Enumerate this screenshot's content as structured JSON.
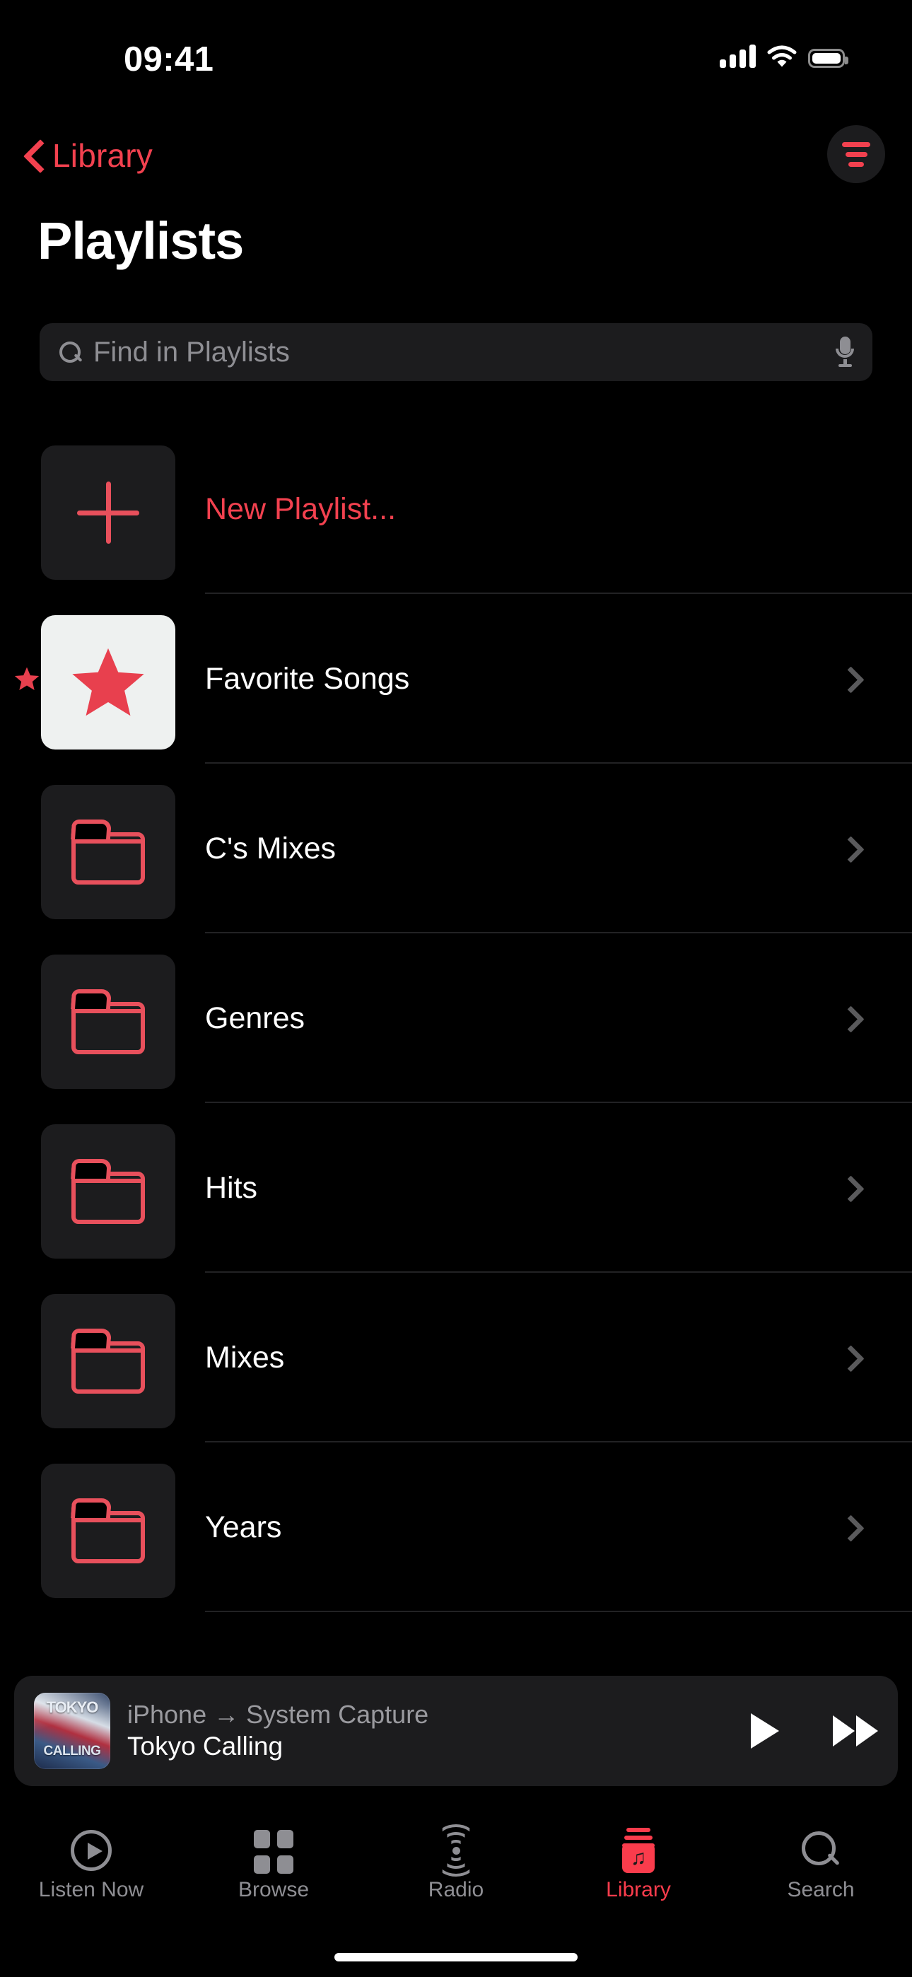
{
  "status_bar": {
    "time": "09:41",
    "cellular_icon": "cellular-bars-icon",
    "wifi_icon": "wifi-icon",
    "battery_icon": "battery-full-icon"
  },
  "nav": {
    "back_label": "Library",
    "back_icon": "chevron-left-icon",
    "sort_icon": "sort-filter-icon"
  },
  "page_title": "Playlists",
  "search": {
    "placeholder": "Find in Playlists",
    "value": "",
    "search_icon": "search-icon",
    "mic_icon": "microphone-icon"
  },
  "list": [
    {
      "label": "New Playlist...",
      "icon": "plus-icon",
      "accent": true,
      "chevron": false,
      "thumb_style": "dark"
    },
    {
      "label": "Favorite Songs",
      "icon": "star-icon",
      "accent": false,
      "chevron": true,
      "thumb_style": "light",
      "badge": "star-badge"
    },
    {
      "label": "C's Mixes",
      "icon": "folder-icon",
      "accent": false,
      "chevron": true,
      "thumb_style": "dark"
    },
    {
      "label": "Genres",
      "icon": "folder-icon",
      "accent": false,
      "chevron": true,
      "thumb_style": "dark"
    },
    {
      "label": "Hits",
      "icon": "folder-icon",
      "accent": false,
      "chevron": true,
      "thumb_style": "dark"
    },
    {
      "label": "Mixes",
      "icon": "folder-icon",
      "accent": false,
      "chevron": true,
      "thumb_style": "dark"
    },
    {
      "label": "Years",
      "icon": "folder-icon",
      "accent": false,
      "chevron": true,
      "thumb_style": "dark"
    }
  ],
  "mini_player": {
    "route": "iPhone → System Capture",
    "track": "Tokyo Calling",
    "artwork_line1": "TOKYO",
    "artwork_line2": "CALLING",
    "play_icon": "play-icon",
    "forward_icon": "fast-forward-icon"
  },
  "tab_bar": {
    "items": [
      {
        "label": "Listen Now",
        "icon": "listen-now-icon",
        "active": false
      },
      {
        "label": "Browse",
        "icon": "browse-icon",
        "active": false
      },
      {
        "label": "Radio",
        "icon": "radio-icon",
        "active": false
      },
      {
        "label": "Library",
        "icon": "library-icon",
        "active": true
      },
      {
        "label": "Search",
        "icon": "search-icon",
        "active": false
      }
    ]
  },
  "colors": {
    "accent_red": "#fa3c4c",
    "nav_red": "#f2414f",
    "background": "#000000",
    "surface": "#1c1c1e",
    "secondary_text": "#8e8e93",
    "separator": "#222224"
  }
}
